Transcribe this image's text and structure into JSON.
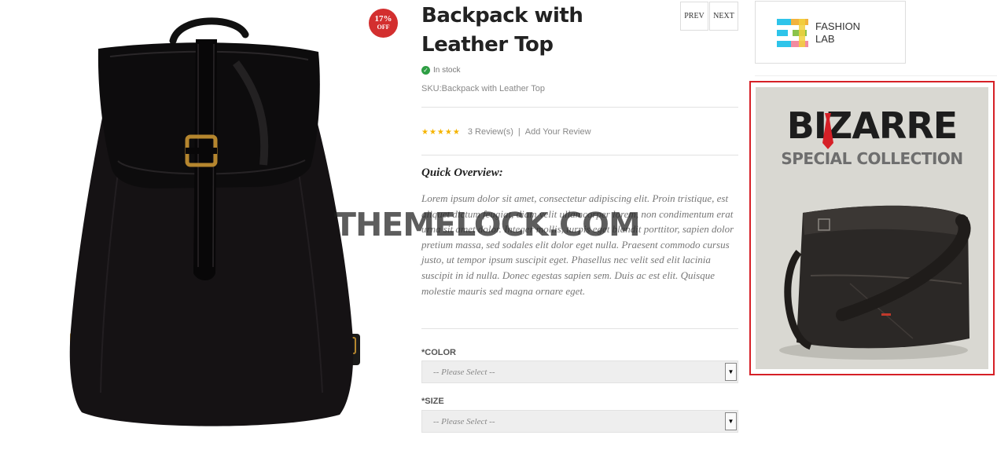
{
  "badge": {
    "percent": "17%",
    "off": "OFF"
  },
  "product": {
    "title": "Backpack with Leather Top",
    "stock": "In stock",
    "sku": "SKU:Backpack with Leather Top",
    "rating_stars": 5,
    "reviews": "3 Review(s)",
    "separator": "|",
    "add_review": "Add Your Review"
  },
  "nav": {
    "prev": "PREV",
    "next": "NEXT"
  },
  "overview": {
    "title": "Quick Overview:",
    "text": "Lorem ipsum dolor sit amet, consectetur adipiscing elit. Proin tristique, est aliquet dictum feugiat, diam velit ullamcorper lorem, non condimentum erat urna sit amet dolor. Integer mollis, turpis eget blandit porttitor, sapien dolor pretium massa, sed sodales elit dolor eget nulla. Praesent commodo cursus justo, ut tempor ipsum suscipit eget. Phasellus nec velit sed elit lacinia suscipit in id nulla. Donec egestas sapien sem. Duis ac est elit. Quisque molestie mauris sed magna ornare eget."
  },
  "options": {
    "color_label": "*COLOR",
    "color_placeholder": "-- Please Select --",
    "size_label": "*SIZE",
    "size_placeholder": "-- Please Select --"
  },
  "watermark": "THEMELOCK.COM",
  "sidebar": {
    "brand": {
      "line1": "FASHION",
      "line2": "LAB"
    },
    "promo": {
      "title": "BIZARRE",
      "subtitle": "SPECIAL COLLECTION"
    }
  },
  "colors": {
    "badge": "#d32f2f",
    "stars": "#f5b400",
    "in_stock": "#2e9e44",
    "promo_border": "#d62027"
  },
  "icons": [
    "check-circle-icon",
    "star-icon",
    "dropdown-arrow-icon",
    "fashion-lab-logo-icon",
    "necktie-icon"
  ]
}
